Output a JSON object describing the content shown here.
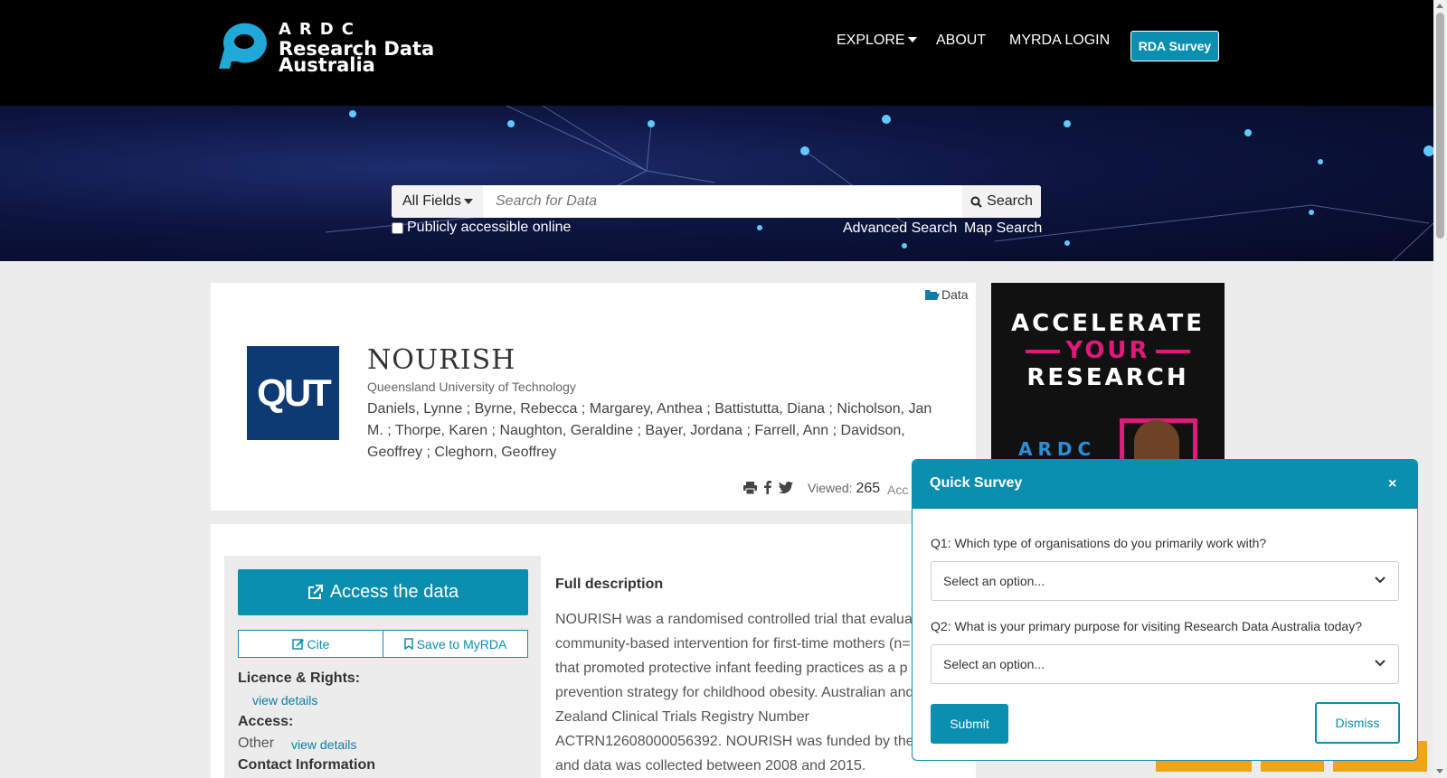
{
  "header": {
    "logo_ardc": "ARDC",
    "logo_line1": "Research Data",
    "logo_line2": "Australia",
    "nav": {
      "explore": "EXPLORE",
      "about": "ABOUT",
      "login": "MYRDA LOGIN"
    },
    "survey_button": "RDA Survey"
  },
  "search": {
    "field_select": "All Fields",
    "placeholder": "Search for Data",
    "button": "Search",
    "public_checkbox": "Publicly accessible online",
    "public_checked": false,
    "advanced": "Advanced Search",
    "map": "Map Search"
  },
  "record": {
    "type_tag": "Data",
    "logo_text": "QUT",
    "title": "NOURISH",
    "organisation": "Queensland University of Technology",
    "authors": "Daniels, Lynne ; Byrne, Rebecca ; Margarey, Anthea ; Battistutta, Diana ; Nicholson, Jan M. ; Thorpe, Karen ; Naughton, Geraldine ; Bayer, Jordana ; Farrell, Ann ; Davidson, Geoffrey ; Cleghorn, Geoffrey",
    "viewed_label": "Viewed:",
    "viewed_count": "265",
    "accessed_truncated": "Acc"
  },
  "ad": {
    "line1": "ACCELERATE",
    "line2": "YOUR",
    "line3": "RESEARCH",
    "brand": "ARDC"
  },
  "sidebar": {
    "access_button": "Access the data",
    "cite_button": "Cite",
    "save_button": "Save to MyRDA",
    "licence_label": "Licence & Rights:",
    "licence_link": "view details",
    "access_label": "Access:",
    "access_value": "Other",
    "access_link": "view details",
    "contact_label": "Contact Information"
  },
  "description": {
    "heading": "Full description",
    "lines": [
      "NOURISH was a randomised controlled trial that evaluat",
      "community-based intervention for first-time mothers (n=",
      "that promoted protective infant feeding practices as a p",
      "prevention strategy for childhood obesity. Australian and",
      "Zealand Clinical Trials Registry Number",
      "ACTRN12608000056392. NOURISH was funded by the",
      "and data was collected between 2008 and 2015."
    ]
  },
  "survey": {
    "title": "Quick Survey",
    "close": "×",
    "q1": "Q1: Which type of organisations do you primarily work with?",
    "q1_value": "Select an option...",
    "q2": "Q2: What is your primary purpose for visiting Research Data Australia today?",
    "q2_value": "Select an option...",
    "submit": "Submit",
    "dismiss": "Dismiss"
  },
  "colors": {
    "accent": "#0a8fb0",
    "header_bg": "#000000",
    "qut_blue": "#0d3a72",
    "ad_pink": "#e0197d",
    "link": "#0a7fa3"
  }
}
